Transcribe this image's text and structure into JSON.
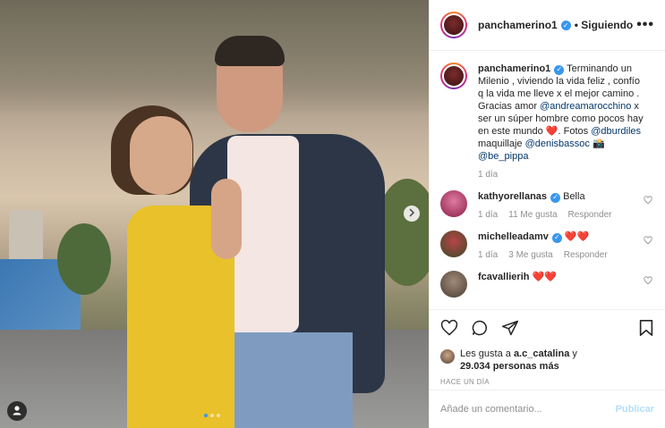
{
  "header": {
    "username": "panchamerino1",
    "follow_label": "• Siguiendo",
    "more_icon": "more-horizontal-icon"
  },
  "caption": {
    "username": "panchamerino1",
    "parts": {
      "text1": " Terminando un Milenio , viviendo la vida feliz , confío q la vida me lleve x el mejor camino . Gracias amor ",
      "mention1": "@andreamarocchino",
      "text2": " x ser un súper hombre como pocos hay en este mundo ",
      "heart": "❤️",
      "text3": ". Fotos ",
      "mention2": "@dburdiles",
      "text4": " maquillaje ",
      "mention3": "@denisbassoc",
      "emoji": "📸",
      "mention4": "@be_pippa"
    },
    "time": "1 día"
  },
  "comments": [
    {
      "username": "kathyorellanas",
      "text": " Bella",
      "time": "1 día",
      "likes": "11 Me gusta",
      "reply": "Responder",
      "avatar_color": "#c62f6e"
    },
    {
      "username": "michelleadamv",
      "text": " ❤️❤️",
      "time": "1 día",
      "likes": "3 Me gusta",
      "reply": "Responder",
      "avatar_color": "#4e5a3a"
    },
    {
      "username": "fcavallierih",
      "text": " ❤️❤️",
      "avatar_color": "#7a6a5c"
    }
  ],
  "likes": {
    "line1": "Les gusta a ",
    "user": "a.c_catalina",
    "line1b": " y",
    "line2": "29.034 personas más"
  },
  "posted": "HACE UN DÍA",
  "add_comment": {
    "placeholder": "Añade un comentario...",
    "publish": "Publicar"
  },
  "colors": {
    "accent": "#3897f0",
    "mention": "#00376b",
    "muted": "#8e8e8e",
    "publish_disabled": "#b2dffc"
  }
}
